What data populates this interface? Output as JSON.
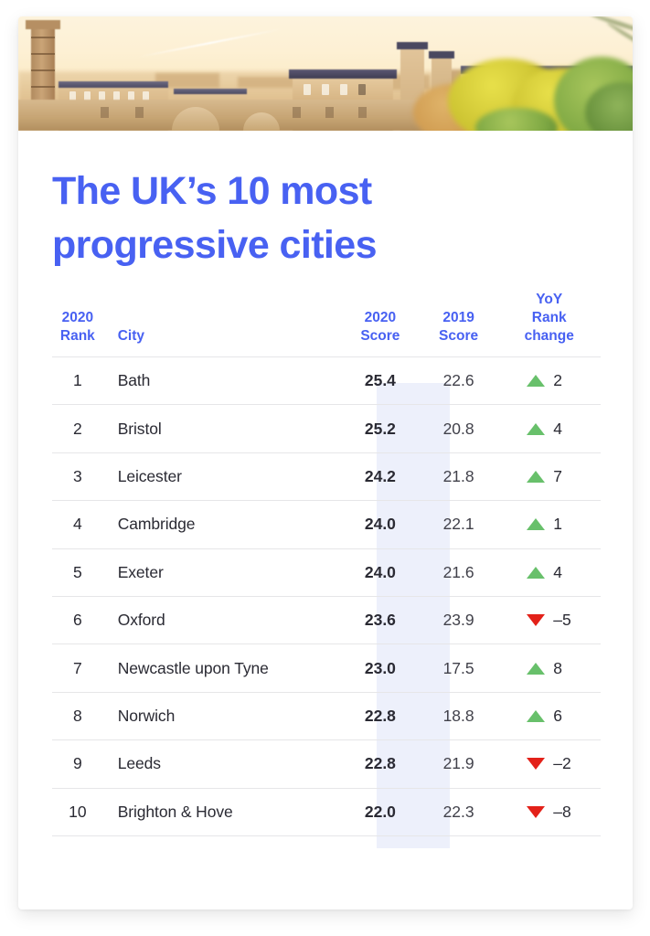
{
  "hero": {
    "alt": "Aerial view of Bath city skyline with honey-coloured stone buildings and autumn trees at golden hour"
  },
  "headline": "The UK’s 10 most progressive cities",
  "colors": {
    "accent_blue": "#4861f2",
    "score_band": "#edf0fb",
    "up_green": "#68c06b",
    "down_red": "#e32119",
    "row_rule": "#e6e6e8",
    "body_text": "#2a2a33"
  },
  "table": {
    "headers": {
      "rank": "2020\nRank",
      "city": "City",
      "score_2020": "2020\nScore",
      "score_2019": "2019\nScore",
      "yoy": "YoY\nRank\nchange"
    },
    "rows": [
      {
        "rank": "1",
        "city": "Bath",
        "score_2020": "25.4",
        "score_2019": "22.6",
        "direction": "up",
        "change": "2"
      },
      {
        "rank": "2",
        "city": "Bristol",
        "score_2020": "25.2",
        "score_2019": "20.8",
        "direction": "up",
        "change": "4"
      },
      {
        "rank": "3",
        "city": "Leicester",
        "score_2020": "24.2",
        "score_2019": "21.8",
        "direction": "up",
        "change": "7"
      },
      {
        "rank": "4",
        "city": "Cambridge",
        "score_2020": "24.0",
        "score_2019": "22.1",
        "direction": "up",
        "change": "1"
      },
      {
        "rank": "5",
        "city": "Exeter",
        "score_2020": "24.0",
        "score_2019": "21.6",
        "direction": "up",
        "change": "4"
      },
      {
        "rank": "6",
        "city": "Oxford",
        "score_2020": "23.6",
        "score_2019": "23.9",
        "direction": "down",
        "change": "–5"
      },
      {
        "rank": "7",
        "city": "Newcastle upon Tyne",
        "score_2020": "23.0",
        "score_2019": "17.5",
        "direction": "up",
        "change": "8"
      },
      {
        "rank": "8",
        "city": "Norwich",
        "score_2020": "22.8",
        "score_2019": "18.8",
        "direction": "up",
        "change": "6"
      },
      {
        "rank": "9",
        "city": "Leeds",
        "score_2020": "22.8",
        "score_2019": "21.9",
        "direction": "down",
        "change": "–2"
      },
      {
        "rank": "10",
        "city": "Brighton & Hove",
        "score_2020": "22.0",
        "score_2019": "22.3",
        "direction": "down",
        "change": "–8"
      }
    ]
  },
  "chart_data": {
    "type": "table",
    "title": "The UK’s 10 most progressive cities",
    "columns": [
      "2020 Rank",
      "City",
      "2020 Score",
      "2019 Score",
      "YoY Rank change"
    ],
    "categories": [
      "Bath",
      "Bristol",
      "Leicester",
      "Cambridge",
      "Exeter",
      "Oxford",
      "Newcastle upon Tyne",
      "Norwich",
      "Leeds",
      "Brighton & Hove"
    ],
    "series": [
      {
        "name": "2020 Score",
        "values": [
          25.4,
          25.2,
          24.2,
          24.0,
          24.0,
          23.6,
          23.0,
          22.8,
          22.8,
          22.0
        ]
      },
      {
        "name": "2019 Score",
        "values": [
          22.6,
          20.8,
          21.8,
          22.1,
          21.6,
          23.9,
          17.5,
          18.8,
          21.9,
          22.3
        ]
      },
      {
        "name": "YoY Rank change",
        "values": [
          2,
          4,
          7,
          1,
          4,
          -5,
          8,
          6,
          -2,
          -8
        ]
      }
    ],
    "ranks": [
      1,
      2,
      3,
      4,
      5,
      6,
      7,
      8,
      9,
      10
    ],
    "xlabel": "City",
    "ylabel": "Score",
    "legend_position": "none",
    "grid": false
  }
}
